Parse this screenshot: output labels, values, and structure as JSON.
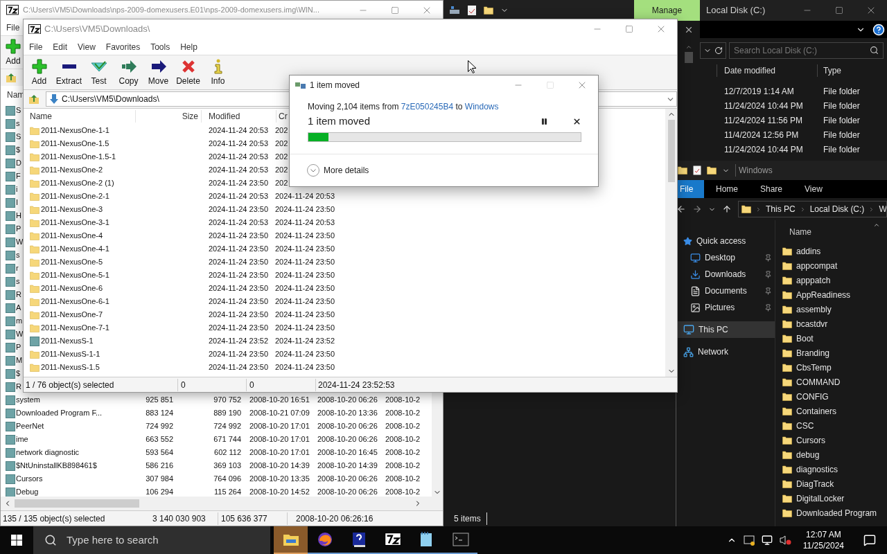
{
  "back_window": {
    "title": "C:\\Users\\VM5\\Downloads\\nps-2009-domexusers.E01\\nps-2009-domexusers.img\\WIN...",
    "menu": [
      "File"
    ],
    "toolbar": [
      {
        "label": "Add",
        "kind": "add"
      }
    ],
    "column_1": "Nam",
    "rows": [
      {
        "cells": [
          "S"
        ]
      },
      {
        "cells": [
          "s"
        ]
      },
      {
        "cells": [
          "S"
        ]
      },
      {
        "cells": [
          "$"
        ]
      },
      {
        "cells": [
          "D"
        ]
      },
      {
        "cells": [
          "F"
        ]
      },
      {
        "cells": [
          "i"
        ]
      },
      {
        "cells": [
          "I"
        ]
      },
      {
        "cells": [
          "H"
        ]
      },
      {
        "cells": [
          "P"
        ]
      },
      {
        "cells": [
          "W"
        ]
      },
      {
        "cells": [
          "s"
        ]
      },
      {
        "cells": [
          "r"
        ]
      },
      {
        "cells": [
          "s"
        ]
      },
      {
        "cells": [
          "R"
        ]
      },
      {
        "cells": [
          "A"
        ]
      },
      {
        "cells": [
          "m"
        ]
      },
      {
        "cells": [
          "W"
        ]
      },
      {
        "cells": [
          "P"
        ]
      },
      {
        "cells": [
          "M"
        ]
      },
      {
        "cells": [
          "$"
        ]
      },
      {
        "cells": [
          "R"
        ]
      },
      {
        "cells": [
          "system",
          "925 851",
          "970 752",
          "2008-10-20 16:51",
          "2008-10-20 06:26",
          "2008-10-2"
        ]
      },
      {
        "cells": [
          "Downloaded Program F...",
          "883 124",
          "889 190",
          "2008-10-21 07:09",
          "2008-10-20 13:36",
          "2008-10-2"
        ]
      },
      {
        "cells": [
          "PeerNet",
          "724 992",
          "724 992",
          "2008-10-20 17:01",
          "2008-10-20 06:26",
          "2008-10-2"
        ]
      },
      {
        "cells": [
          "ime",
          "663 552",
          "671 744",
          "2008-10-20 17:01",
          "2008-10-20 06:26",
          "2008-10-2"
        ]
      },
      {
        "cells": [
          "network diagnostic",
          "593 564",
          "602 112",
          "2008-10-20 17:01",
          "2008-10-20 16:45",
          "2008-10-2"
        ]
      },
      {
        "cells": [
          "$NtUninstallKB898461$",
          "586 216",
          "369 103",
          "2008-10-20 14:39",
          "2008-10-20 14:39",
          "2008-10-2"
        ]
      },
      {
        "cells": [
          "Cursors",
          "307 984",
          "764 096",
          "2008-10-20 13:35",
          "2008-10-20 06:26",
          "2008-10-2"
        ]
      },
      {
        "cells": [
          "Debug",
          "106 294",
          "115 264",
          "2008-10-20 14:52",
          "2008-10-20 06:26",
          "2008-10-2"
        ]
      }
    ],
    "status_bar": [
      "135 / 135 object(s) selected",
      "3 140 030 903",
      "105 636 377",
      "2008-10-20 06:26:16"
    ]
  },
  "front_window": {
    "title": "C:\\Users\\VM5\\Downloads\\",
    "menu": [
      "File",
      "Edit",
      "View",
      "Favorites",
      "Tools",
      "Help"
    ],
    "toolbar": [
      {
        "label": "Add",
        "kind": "add"
      },
      {
        "label": "Extract",
        "kind": "extract"
      },
      {
        "label": "Test",
        "kind": "test"
      },
      {
        "label": "Copy",
        "kind": "copy"
      },
      {
        "label": "Move",
        "kind": "move"
      },
      {
        "label": "Delete",
        "kind": "delete"
      },
      {
        "label": "Info",
        "kind": "info"
      }
    ],
    "address": "C:\\Users\\VM5\\Downloads\\",
    "columns": [
      "Name",
      "Size",
      "Modified",
      "Cr"
    ],
    "rows": [
      {
        "name": "2011-NexusOne-1-1",
        "kind": "folder",
        "modified": "2024-11-24 20:53",
        "created": "202"
      },
      {
        "name": "2011-NexusOne-1.5",
        "kind": "folder",
        "modified": "2024-11-24 20:53",
        "created": "202"
      },
      {
        "name": "2011-NexusOne-1.5-1",
        "kind": "folder",
        "modified": "2024-11-24 20:53",
        "created": "202"
      },
      {
        "name": "2011-NexusOne-2",
        "kind": "folder",
        "modified": "2024-11-24 20:53",
        "created": "202"
      },
      {
        "name": "2011-NexusOne-2 (1)",
        "kind": "folder",
        "modified": "2024-11-24 23:50",
        "created": "202"
      },
      {
        "name": "2011-NexusOne-2-1",
        "kind": "folder",
        "modified": "2024-11-24 20:53",
        "created": "2024-11-24 20:53"
      },
      {
        "name": "2011-NexusOne-3",
        "kind": "folder",
        "modified": "2024-11-24 23:50",
        "created": "2024-11-24 23:50"
      },
      {
        "name": "2011-NexusOne-3-1",
        "kind": "folder",
        "modified": "2024-11-24 20:53",
        "created": "2024-11-24 20:53"
      },
      {
        "name": "2011-NexusOne-4",
        "kind": "folder",
        "modified": "2024-11-24 23:50",
        "created": "2024-11-24 23:50"
      },
      {
        "name": "2011-NexusOne-4-1",
        "kind": "folder",
        "modified": "2024-11-24 23:50",
        "created": "2024-11-24 23:50"
      },
      {
        "name": "2011-NexusOne-5",
        "kind": "folder",
        "modified": "2024-11-24 23:50",
        "created": "2024-11-24 23:50"
      },
      {
        "name": "2011-NexusOne-5-1",
        "kind": "folder",
        "modified": "2024-11-24 23:50",
        "created": "2024-11-24 23:50"
      },
      {
        "name": "2011-NexusOne-6",
        "kind": "folder",
        "modified": "2024-11-24 23:50",
        "created": "2024-11-24 23:50"
      },
      {
        "name": "2011-NexusOne-6-1",
        "kind": "folder",
        "modified": "2024-11-24 23:50",
        "created": "2024-11-24 23:50"
      },
      {
        "name": "2011-NexusOne-7",
        "kind": "folder",
        "modified": "2024-11-24 23:50",
        "created": "2024-11-24 23:50"
      },
      {
        "name": "2011-NexusOne-7-1",
        "kind": "folder",
        "modified": "2024-11-24 23:50",
        "created": "2024-11-24 23:50"
      },
      {
        "name": "2011-NexusS-1",
        "kind": "disk",
        "modified": "2024-11-24 23:52",
        "created": "2024-11-24 23:52"
      },
      {
        "name": "2011-NexusS-1-1",
        "kind": "folder",
        "modified": "2024-11-24 23:50",
        "created": "2024-11-24 23:50"
      },
      {
        "name": "2011-NexusS-1.5",
        "kind": "folder",
        "modified": "2024-11-24 23:50",
        "created": "2024-11-24 23:50"
      }
    ],
    "status_bar": [
      "1 / 76 object(s) selected",
      "0",
      "0",
      "2024-11-24 23:52:53"
    ]
  },
  "dialog": {
    "title": "1 item moved",
    "maximize_disabled": true,
    "message": {
      "prefix": "Moving 2,104 items from ",
      "source": "7zE050245B4",
      "middle": " to ",
      "destination": "Windows"
    },
    "status": "1 item moved",
    "level": 0.075,
    "details": "More details"
  },
  "disk_window": {
    "tab": "Manage",
    "title": "Local Disk (C:)",
    "search": {
      "placeholder": "Search Local Disk (C:)"
    },
    "columns": [
      "Date modified",
      "Type"
    ],
    "rows": [
      {
        "date": "12/7/2019 1:14 AM",
        "type": "File folder"
      },
      {
        "date": "11/24/2024 10:44 PM",
        "type": "File folder"
      },
      {
        "date": "11/24/2024 11:56 PM",
        "type": "File folder"
      },
      {
        "date": "11/4/2024 12:56 PM",
        "type": "File folder"
      },
      {
        "date": "11/24/2024 10:44 PM",
        "type": "File folder"
      }
    ],
    "status": "5 items"
  },
  "windows_window": {
    "title": "Windows",
    "ribbon_tabs": [
      {
        "label": "File",
        "selected": true
      },
      {
        "label": "Home",
        "selected": false
      },
      {
        "label": "Share",
        "selected": false
      },
      {
        "label": "View",
        "selected": false
      }
    ],
    "breadcrumb": [
      "This PC",
      "Local Disk (C:)",
      "W"
    ],
    "nav": [
      {
        "label": "Quick access",
        "kind": "star",
        "selected": false,
        "children": [
          {
            "label": "Desktop",
            "kind": "desktop",
            "pinned": true,
            "selected": false
          },
          {
            "label": "Downloads",
            "kind": "download",
            "pinned": true,
            "selected": false
          },
          {
            "label": "Documents",
            "kind": "document",
            "pinned": true,
            "selected": false
          },
          {
            "label": "Pictures",
            "kind": "pictures",
            "pinned": true,
            "selected": false
          }
        ]
      },
      {
        "label": "This PC",
        "kind": "pc",
        "selected": true
      },
      {
        "label": "Network",
        "kind": "network",
        "selected": false
      }
    ],
    "column": "Name",
    "folders": [
      "addins",
      "appcompat",
      "apppatch",
      "AppReadiness",
      "assembly",
      "bcastdvr",
      "Boot",
      "Branding",
      "CbsTemp",
      "COMMAND",
      "CONFIG",
      "Containers",
      "CSC",
      "Cursors",
      "debug",
      "diagnostics",
      "DiagTrack",
      "DigitalLocker",
      "Downloaded Program"
    ]
  },
  "taskbar": {
    "search": {
      "placeholder": "Type here to search"
    },
    "apps": [
      {
        "kind": "explorer",
        "active": true
      },
      {
        "kind": "firefox",
        "active": false
      },
      {
        "kind": "help",
        "active": false
      },
      {
        "kind": "sevenzip",
        "active": false
      },
      {
        "kind": "notepad",
        "active": false
      },
      {
        "kind": "terminal",
        "active": false
      }
    ],
    "time": "12:07 AM",
    "date": "11/25/2024"
  }
}
